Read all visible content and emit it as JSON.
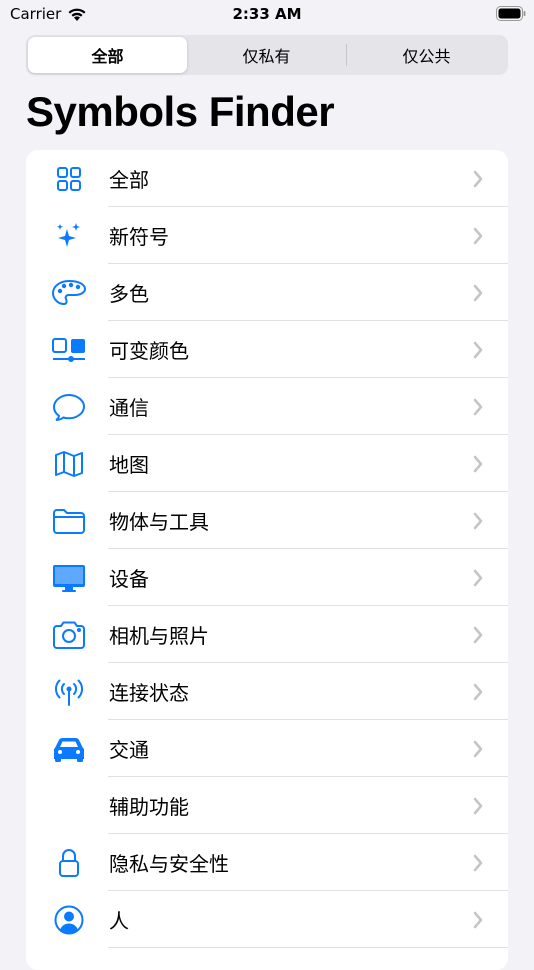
{
  "status_bar": {
    "carrier": "Carrier",
    "time": "2:33 AM"
  },
  "segmented_control": {
    "segments": [
      "全部",
      "仅私有",
      "仅公共"
    ],
    "selected_index": 0
  },
  "page_title": "Symbols Finder",
  "accent_color": "#0a7aff",
  "list": {
    "items": [
      {
        "label": "全部",
        "icon": "grid-icon"
      },
      {
        "label": "新符号",
        "icon": "sparkles-icon"
      },
      {
        "label": "多色",
        "icon": "paint-palette-icon"
      },
      {
        "label": "可变颜色",
        "icon": "variable-color-icon"
      },
      {
        "label": "通信",
        "icon": "speech-bubble-icon"
      },
      {
        "label": "地图",
        "icon": "map-icon"
      },
      {
        "label": "物体与工具",
        "icon": "folder-icon"
      },
      {
        "label": "设备",
        "icon": "desktop-monitor-icon"
      },
      {
        "label": "相机与照片",
        "icon": "camera-icon"
      },
      {
        "label": "连接状态",
        "icon": "antenna-icon"
      },
      {
        "label": "交通",
        "icon": "car-icon"
      },
      {
        "label": "辅助功能",
        "icon": ""
      },
      {
        "label": "隐私与安全性",
        "icon": "lock-icon"
      },
      {
        "label": "人",
        "icon": "person-circle-icon"
      }
    ]
  }
}
